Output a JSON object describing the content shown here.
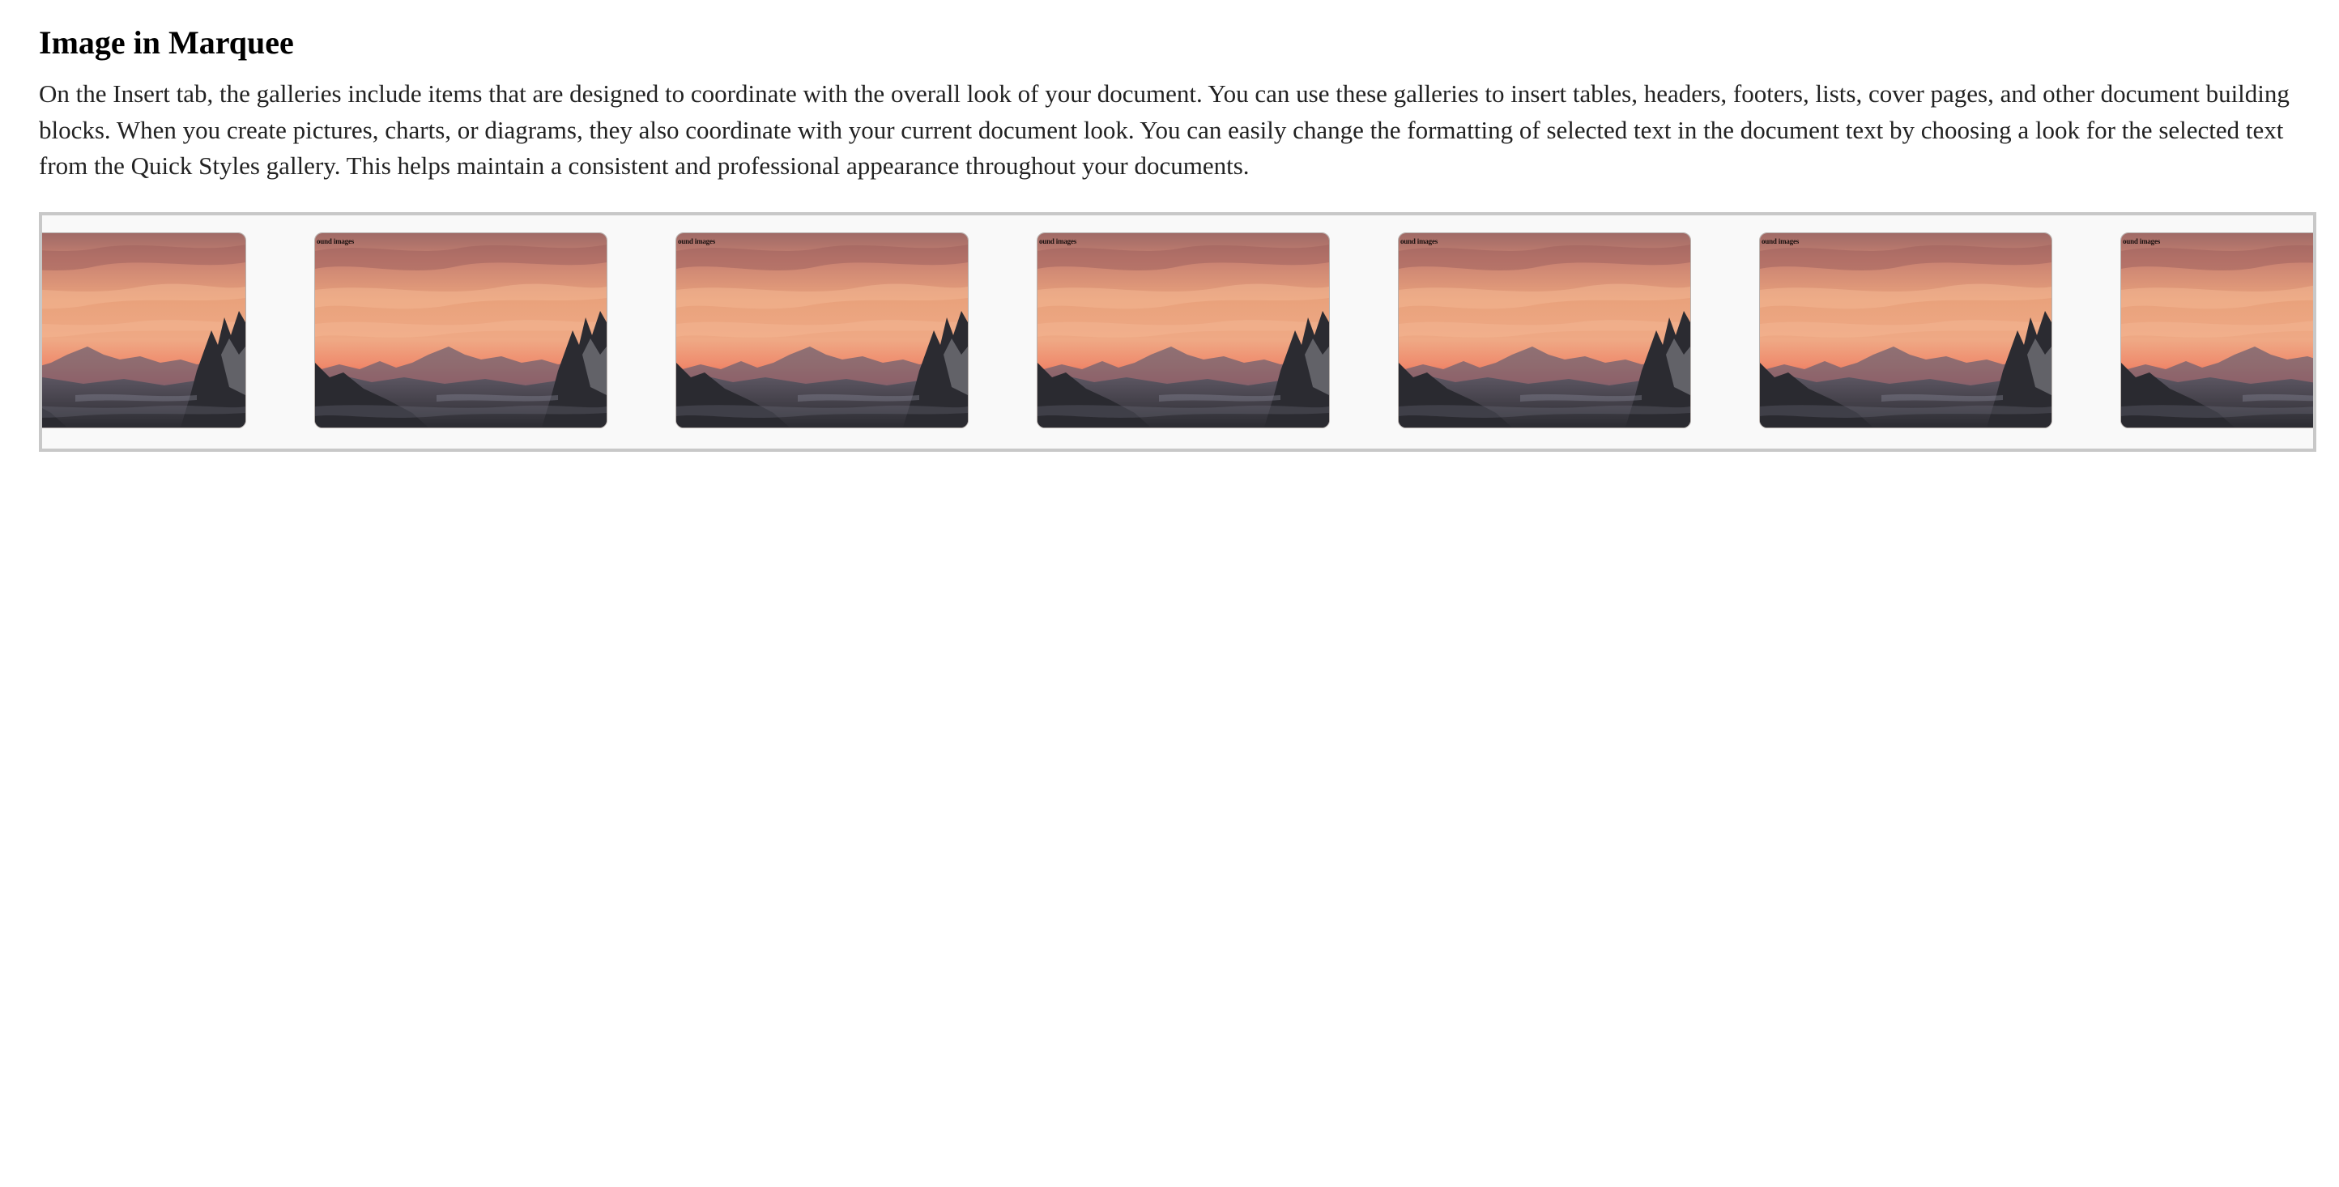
{
  "page": {
    "title": "Image in Marquee",
    "intro": "On the Insert tab, the galleries include items that are designed to coordinate with the overall look of your document. You can use these galleries to insert tables, headers, footers, lists, cover pages, and other document building blocks. When you create pictures, charts, or diagrams, they also coordinate with your current document look. You can easily change the formatting of selected text in the document text by choosing a look for the selected text from the Quick Styles gallery. This helps maintain a consistent and professional appearance throughout your documents."
  },
  "marquee": {
    "tile_caption": "ound images",
    "tile_count": 7,
    "image_subject": "sunset-mountain-landscape",
    "colors": {
      "border": "#c8c8c8",
      "background": "#f9f9f9",
      "sky_top": "#b87a6b",
      "sky_mid": "#e8a07a",
      "sky_glow": "#ec6a58",
      "mountains": "#3a3a40"
    }
  }
}
